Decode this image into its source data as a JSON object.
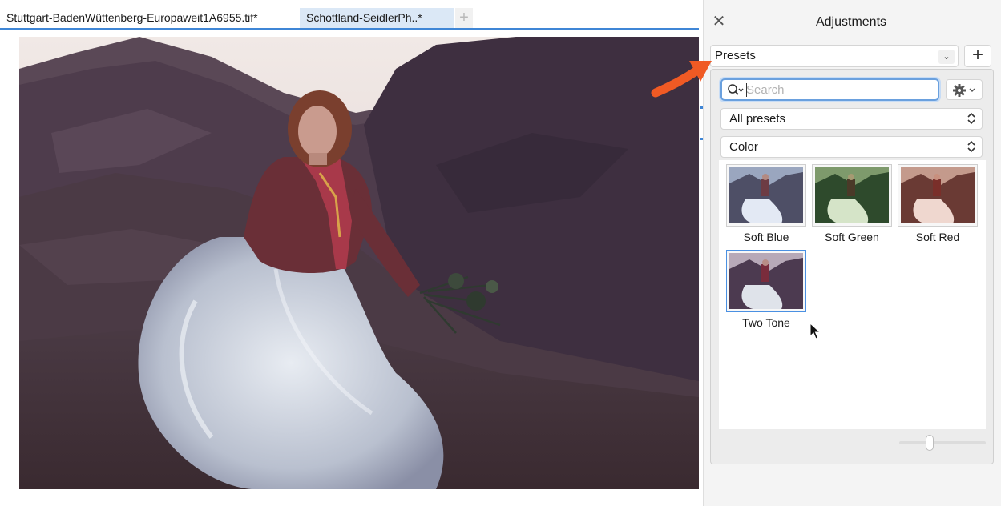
{
  "document_tabs": [
    {
      "label": "Stuttgart-BadenWüttenberg-Europaweit1A6955.tif*",
      "active": false
    },
    {
      "label": "Schottland-SeidlerPh..*",
      "active": true
    }
  ],
  "new_tab_icon": "plus-icon",
  "panel": {
    "title": "Adjustments",
    "close_icon": "close-icon",
    "presets_dropdown": {
      "value": "Presets"
    },
    "add_icon": "plus-icon",
    "search": {
      "placeholder": "Search",
      "value": ""
    },
    "gear_icon": "gear-icon",
    "category_select": {
      "value": "All presets"
    },
    "subcategory_select": {
      "value": "Color"
    },
    "presets": [
      {
        "label": "Soft Blue",
        "tint": "#8fa4c8",
        "selected": false
      },
      {
        "label": "Soft Green",
        "tint": "#5f8f4f",
        "selected": false
      },
      {
        "label": "Soft Red",
        "tint": "#b06a5a",
        "selected": false
      },
      {
        "label": "Two Tone",
        "tint": "#7a5a8c",
        "selected": true
      }
    ],
    "thumbnail_size_slider": {
      "value": 0.35
    }
  },
  "colors": {
    "accent": "#3f86d6",
    "annotation_arrow": "#f05a24"
  }
}
